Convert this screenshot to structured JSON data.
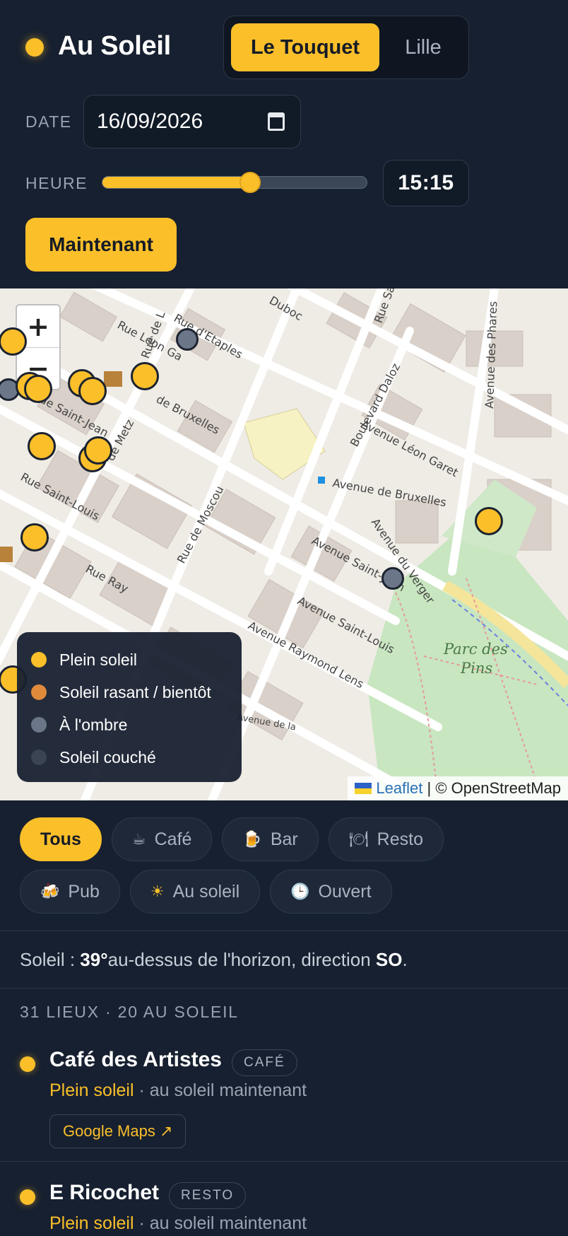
{
  "app": {
    "title": "Au Soleil"
  },
  "cities": [
    {
      "label": "Le Touquet",
      "active": true
    },
    {
      "label": "Lille",
      "active": false
    }
  ],
  "controls": {
    "date_label": "DATE",
    "date_value": "16/09/2026",
    "time_label": "HEURE",
    "time_value": "15:15",
    "slider_fraction": 0.56,
    "now_label": "Maintenant"
  },
  "map": {
    "zoom_in": "+",
    "zoom_out": "−",
    "street_labels": [
      "Rue d'Etaples",
      "Rue Léon Ga",
      "de Bruxelles",
      "ue Saint-Jean",
      "de Metz",
      "Rue de Moscou",
      "Rue Saint-Louis",
      "Boulevard Daloz",
      "Avenue Léon Garet",
      "Avenue de Bruxelles",
      "Avenue du Verger",
      "Avenue Saint-Jean",
      "Avenue Saint-Louis",
      "Avenue Raymond Lens",
      "Avenue des Phares",
      "Parc des",
      "Pins",
      "Duboc",
      "Rue Sain",
      "Rue de L",
      "Rue Ray",
      "Avenue de la"
    ],
    "legend": [
      {
        "label": "Plein soleil",
        "color": "#fbbf2a"
      },
      {
        "label": "Soleil rasant / bientôt",
        "color": "#e08a3c"
      },
      {
        "label": "À l'ombre",
        "color": "#6b7788"
      },
      {
        "label": "Soleil couché",
        "color": "#3a4452"
      }
    ],
    "attribution_link": "Leaflet",
    "attribution_text": "| © OpenStreetMap"
  },
  "filters": [
    {
      "label": "Tous",
      "icon": "",
      "active": true
    },
    {
      "label": "Café",
      "icon": "☕",
      "active": false
    },
    {
      "label": "Bar",
      "icon": "🍺",
      "active": false
    },
    {
      "label": "Resto",
      "icon": "🍽",
      "active": false
    },
    {
      "label": "Pub",
      "icon": "🍻",
      "active": false
    },
    {
      "label": "Au soleil",
      "icon": "☀",
      "active": false
    },
    {
      "label": "Ouvert",
      "icon": "🕒",
      "active": false
    }
  ],
  "sun_info": {
    "prefix": "Soleil : ",
    "altitude": "39°",
    "middle": " au-dessus de l'horizon, direction ",
    "direction": "SO",
    "suffix": "."
  },
  "list_summary": "31 LIEUX · 20 AU SOLEIL",
  "places": [
    {
      "name": "Café des Artistes",
      "badge": "CAFÉ",
      "status": "Plein soleil",
      "detail": " · au soleil maintenant",
      "link": "Google Maps ↗"
    },
    {
      "name": "E Ricochet",
      "badge": "RESTO",
      "status": "Plein soleil",
      "detail": " · au soleil maintenant"
    }
  ]
}
